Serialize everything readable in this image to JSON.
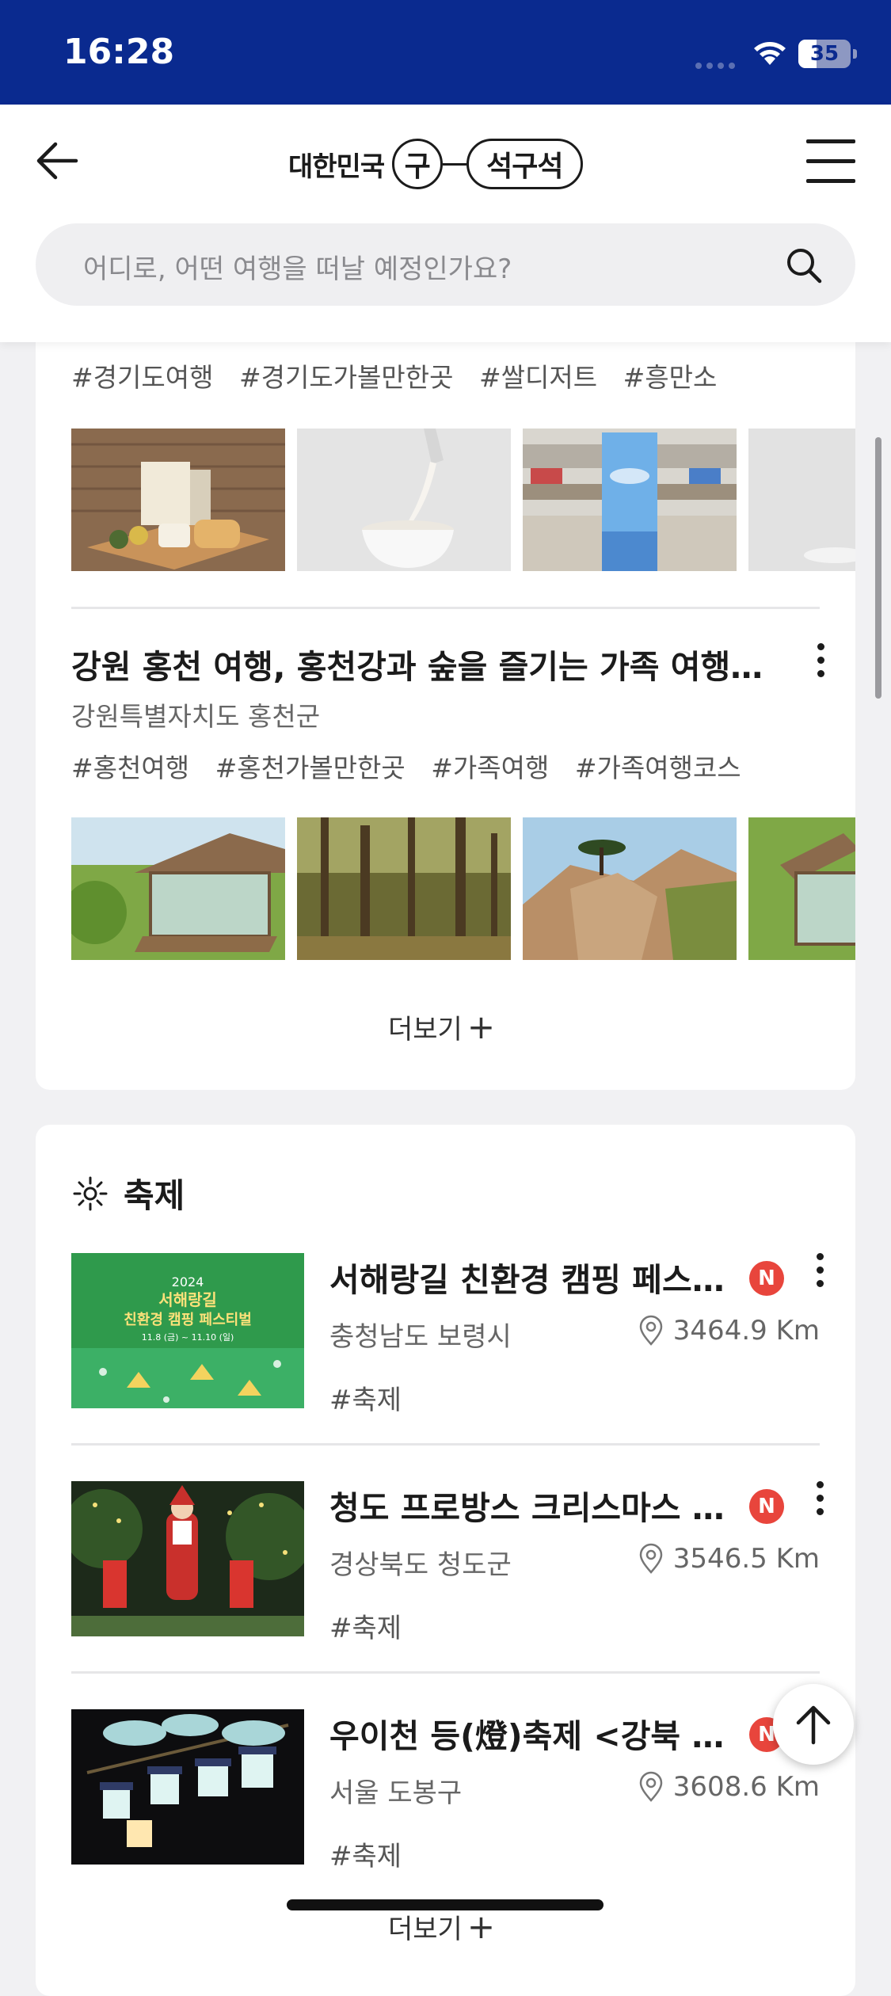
{
  "status_bar": {
    "time": "16:28",
    "battery": "35",
    "battery_level": 0.35
  },
  "header": {
    "logo_word": "대한민국",
    "logo_circle": "구",
    "logo_pill": "석구석",
    "search_placeholder": "어디로, 어떤 여행을 떠날 예정인가요?"
  },
  "card1": {
    "tags_top": [
      "#경기도여행",
      "#경기도가볼만한곳",
      "#쌀디저트",
      "#흥만소"
    ],
    "post": {
      "title": "강원 홍천 여행, 홍천강과 숲을 즐기는 가족 여행 코스",
      "region": "강원특별자치도 홍천군",
      "tags": [
        "#홍천여행",
        "#홍천가볼만한곳",
        "#가족여행",
        "#가족여행코스"
      ]
    },
    "more_label": "더보기"
  },
  "festival": {
    "section_title": "축제",
    "items": [
      {
        "title": "서해랑길 친환경 캠핑 페스티벌",
        "badge": "N",
        "region": "충청남도 보령시",
        "distance": "3464.9 Km",
        "tag": "#축제",
        "poster_year": "2024",
        "poster_line1": "서해랑길",
        "poster_line2": "친환경 캠핑 페스티벌",
        "poster_date": "11.8 (금) ~ 11.10 (일)"
      },
      {
        "title": "청도 프로방스 크리스마스 축제",
        "badge": "N",
        "region": "경상북도 청도군",
        "distance": "3546.5 Km",
        "tag": "#축제"
      },
      {
        "title": "우이천 등(燈)축제 <강북 꿈의 등>",
        "badge": "N",
        "region": "서울 도봉구",
        "distance": "3608.6 Km",
        "tag": "#축제"
      }
    ],
    "more_label": "더보기"
  },
  "icons": {
    "back": "arrow-left-icon",
    "menu": "hamburger-icon",
    "search": "search-icon",
    "location": "map-pin-icon",
    "top": "arrow-up-icon",
    "festival": "sun-icon"
  },
  "colors": {
    "status_bar": "#0a2a8f",
    "badge": "#e8453c"
  }
}
